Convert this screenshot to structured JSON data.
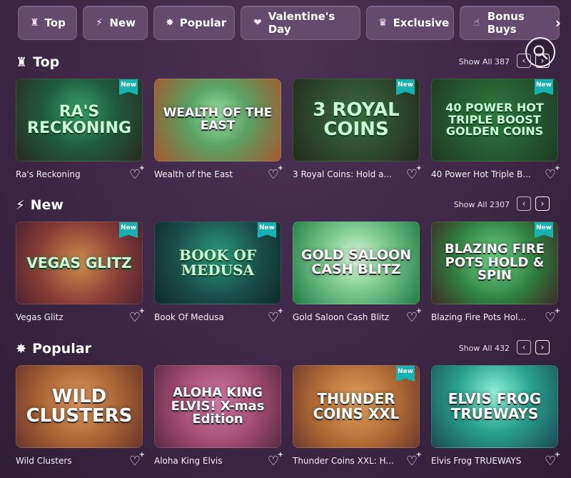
{
  "tabs": [
    {
      "label": "Top",
      "icon": "trophy-icon"
    },
    {
      "label": "New",
      "icon": "lightning-icon"
    },
    {
      "label": "Popular",
      "icon": "star-burst-icon"
    },
    {
      "label": "Valentine's Day",
      "icon": "heart-icon"
    },
    {
      "label": "Exclusive",
      "icon": "crown-icon"
    },
    {
      "label": "Bonus Buys",
      "icon": "hand-icon"
    }
  ],
  "sections": [
    {
      "title": "Top",
      "show_all": "Show All 387",
      "games": [
        {
          "title": "Ra's Reckoning",
          "art": "RA'S RECKONING",
          "badge": "New"
        },
        {
          "title": "Wealth of the East",
          "art": "WEALTH OF THE EAST",
          "badge": ""
        },
        {
          "title": "3 Royal Coins: Hold a...",
          "art": "3 ROYAL COINS",
          "badge": "New"
        },
        {
          "title": "40 Power Hot Triple B...",
          "art": "40 POWER HOT TRIPLE BOOST GOLDEN COINS",
          "badge": "New"
        }
      ]
    },
    {
      "title": "New",
      "show_all": "Show All 2307",
      "games": [
        {
          "title": "Vegas Glitz",
          "art": "VEGAS GLITZ",
          "badge": "New"
        },
        {
          "title": "Book Of Medusa",
          "art": "BOOK OF MEDUSA",
          "badge": "New"
        },
        {
          "title": "Gold Saloon Cash Blitz",
          "art": "GOLD SALOON CASH BLITZ",
          "badge": ""
        },
        {
          "title": "Blazing Fire Pots Hol...",
          "art": "BLAZING FIRE POTS HOLD & SPIN",
          "badge": "New"
        }
      ]
    },
    {
      "title": "Popular",
      "show_all": "Show All 432",
      "games": [
        {
          "title": "Wild Clusters",
          "art": "WILD CLUSTERS",
          "badge": ""
        },
        {
          "title": "Aloha King Elvis",
          "art": "ALOHA KING ELVIS! X-mas Edition",
          "badge": ""
        },
        {
          "title": "Thunder Coins XXL: H...",
          "art": "THUNDER COINS XXL",
          "badge": "New"
        },
        {
          "title": "Elvis Frog TRUEWAYS",
          "art": "ELVIS FROG TRUEWAYS",
          "badge": ""
        }
      ]
    }
  ],
  "colors": {
    "background": "#3e2846",
    "tab": "#644a6c",
    "badge": "#14b3b2"
  }
}
